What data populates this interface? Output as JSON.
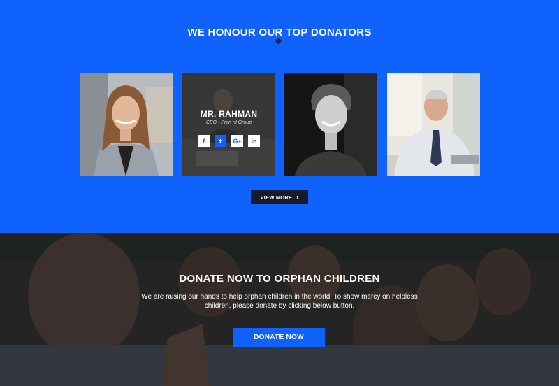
{
  "donators_section": {
    "title": "WE HONOUR OUR TOP DONATORS",
    "featured": {
      "name": "MR. RAHMAN",
      "role": "CEO - Pran rfl Group",
      "socials": [
        "f",
        "t",
        "G+",
        "in"
      ]
    },
    "view_more_label": "VIEW MORE",
    "accent_color": "#0f62fe"
  },
  "donate_section": {
    "title": "DONATE NOW TO ORPHAN CHILDREN",
    "text": "We are raising our hands to help orphan children in the world. To show mercy on helpless children, please donate by clicking below button.",
    "button_label": "DONATE NOW"
  }
}
